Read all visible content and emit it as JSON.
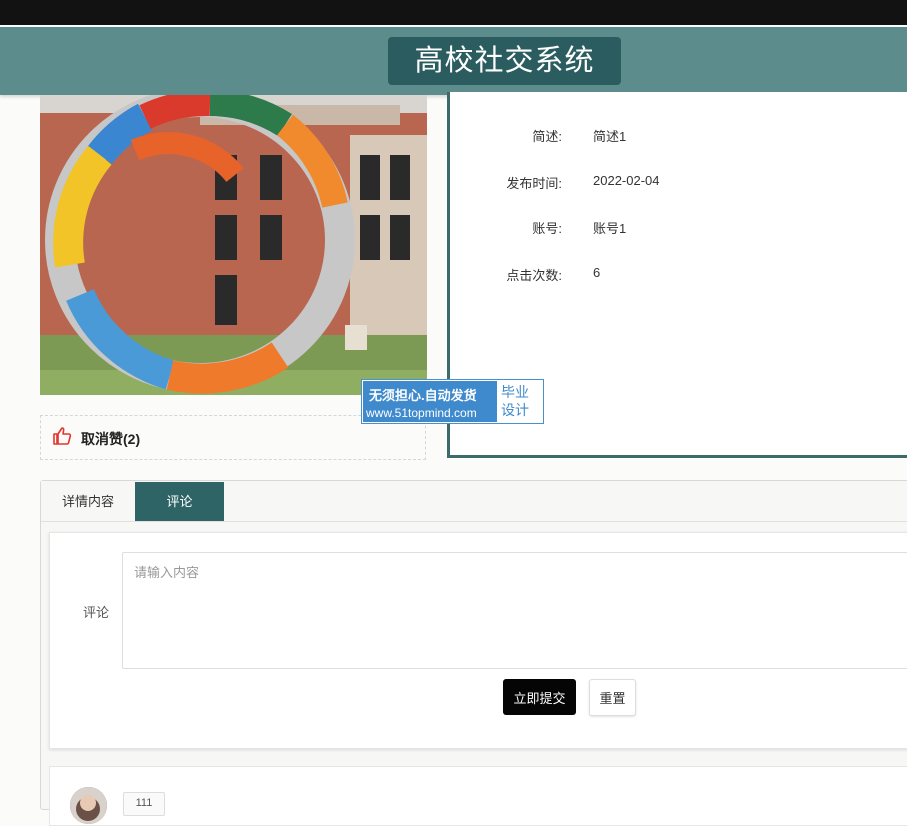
{
  "app": {
    "title": "高校社交系统"
  },
  "details": {
    "items": [
      {
        "label": "简述:",
        "value": "简述1"
      },
      {
        "label": "发布时间:",
        "value": "2022-02-04"
      },
      {
        "label": "账号:",
        "value": "账号1"
      },
      {
        "label": "点击次数:",
        "value": "6"
      }
    ]
  },
  "like": {
    "label": "取消赞(2)",
    "icon": "thumbs-up-icon",
    "color": "#e2362c"
  },
  "watermark": {
    "line1": "无须担心.自动发货",
    "line2": "www.51topmind.com",
    "right1": "毕业",
    "right2": "设计"
  },
  "tabs": [
    {
      "label": "详情内容",
      "active": false
    },
    {
      "label": "评论",
      "active": true
    }
  ],
  "comment_form": {
    "label": "评论",
    "placeholder": "请输入内容",
    "value": "",
    "submit_label": "立即提交",
    "reset_label": "重置"
  },
  "comment_list": {
    "first_user": "111"
  },
  "colors": {
    "header": "#5c8c8c",
    "title_bg": "#2b5d60",
    "accent": "#2f6466",
    "submit": "#050505"
  }
}
